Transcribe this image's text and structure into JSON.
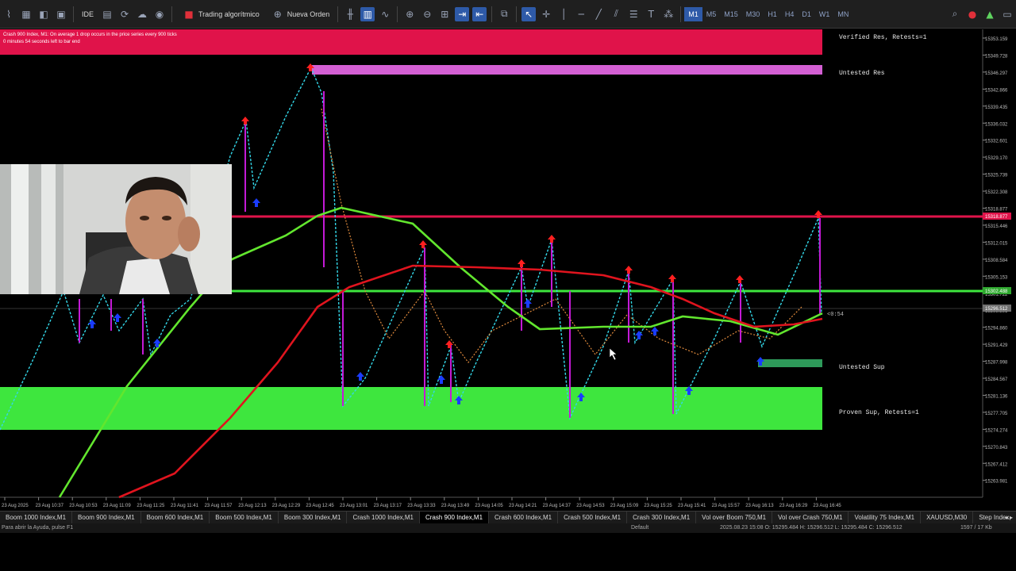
{
  "toolbar": {
    "algo_trading_label": "Trading algorítmico",
    "new_order_label": "Nueva Orden",
    "ide_label": "IDE",
    "timeframes": [
      "M1",
      "M5",
      "M15",
      "M30",
      "H1",
      "H4",
      "D1",
      "W1",
      "MN"
    ],
    "active_timeframe": "M1"
  },
  "chart": {
    "info_line1": "Crash 900 Index, M1:  On average 1 drop occurs in the price series every 900 ticks",
    "info_line2": "0 minutes 54 seconds left to bar end",
    "countdown": "<0:54",
    "zones": [
      {
        "label": "Verified Res, Retests=1",
        "color": "#e0134a"
      },
      {
        "label": "Untested Res",
        "color": "#d35fd3"
      },
      {
        "label": "Untested Sup",
        "color": "#2e9a5a"
      },
      {
        "label": "Proven Sup, Retests=1",
        "color": "#3ee63e"
      }
    ],
    "price_labels": [
      "15353.159",
      "15349.728",
      "15346.297",
      "15342.866",
      "15339.435",
      "15336.032",
      "15332.601",
      "15329.170",
      "15325.739",
      "15322.308",
      "15318.877",
      "15315.446",
      "15312.015",
      "15308.584",
      "15305.153",
      "15301.722",
      "15298.291",
      "15294.860",
      "15291.429",
      "15287.998",
      "15284.567",
      "15281.136",
      "15277.705",
      "15274.274",
      "15270.843",
      "15267.412",
      "15263.981"
    ],
    "red_line_price": "15318.877",
    "green_line_price": "15302.488",
    "current_price_label": "15296.512",
    "time_labels": [
      "23 Aug 2025",
      "23 Aug 10:37",
      "23 Aug 10:53",
      "23 Aug 11:09",
      "23 Aug 11:25",
      "23 Aug 11:41",
      "23 Aug 11:57",
      "23 Aug 12:13",
      "23 Aug 12:29",
      "23 Aug 12:45",
      "23 Aug 13:01",
      "23 Aug 13:17",
      "23 Aug 13:33",
      "23 Aug 13:49",
      "23 Aug 14:05",
      "23 Aug 14:21",
      "23 Aug 14:37",
      "23 Aug 14:53",
      "23 Aug 15:09",
      "23 Aug 15:25",
      "23 Aug 15:41",
      "23 Aug 15:57",
      "23 Aug 16:13",
      "23 Aug 16:29",
      "23 Aug 16:45"
    ],
    "colors": {
      "resistance": "#e0134a",
      "support": "#3ee63e",
      "fast_ma": "#62e62e",
      "slow_ma": "#e0141e",
      "up_wick": "#33d7e8",
      "drop": "#c41ad6",
      "arrow_up": "#1a3cff",
      "arrow_down": "#ff2020"
    }
  },
  "tabs": [
    "Boom 1000 Index,M1",
    "Boom 900 Index,M1",
    "Boom 600 Index,M1",
    "Boom 500 Index,M1",
    "Boom 300 Index,M1",
    "Crash 1000 Index,M1",
    "Crash 900 Index,M1",
    "Crash 600 Index,M1",
    "Crash 500 Index,M1",
    "Crash 300 Index,M1",
    "Vol over Boom 750,M1",
    "Vol over Crash 750,M1",
    "Volatility 75 Index,M1",
    "XAUUSD,M30",
    "Step Index,"
  ],
  "active_tab": "Crash 900 Index,M1",
  "status": {
    "help": "Para abrir la Ayuda, pulse F1",
    "profile": "Default",
    "ohlc": "2025.08.23 15:08     O: 15295.484  H: 15296.512  L: 15295.484  C: 15296.512",
    "traffic": "1597 / 17 Kb"
  }
}
